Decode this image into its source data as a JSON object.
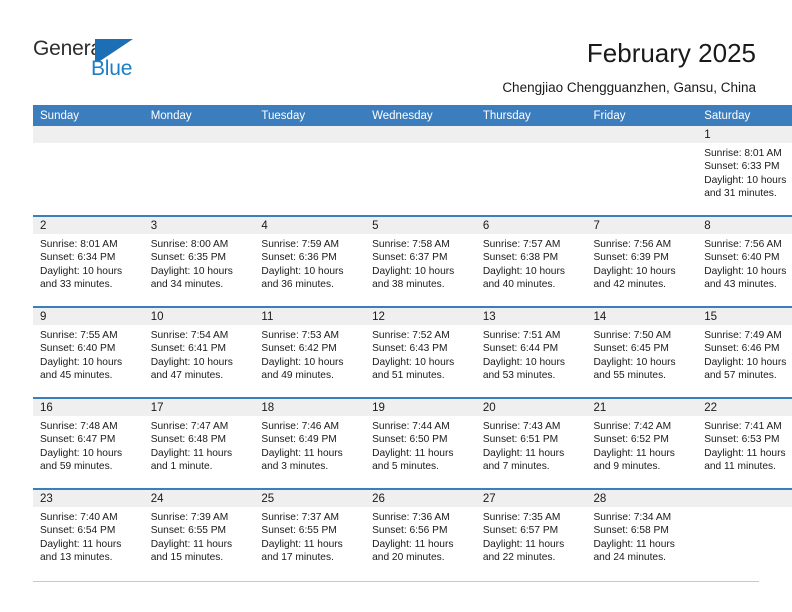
{
  "brand": {
    "name_part1": "General",
    "name_part2": "Blue",
    "logo_icon": "triangle-flag-icon",
    "accent_color": "#1c7fc4"
  },
  "header": {
    "title": "February 2025",
    "subtitle": "Chengjiao Chengguanzhen, Gansu, China"
  },
  "calendar": {
    "header_bg": "#3b7dbd",
    "daynum_band_bg": "#efefef",
    "weekdays": [
      "Sunday",
      "Monday",
      "Tuesday",
      "Wednesday",
      "Thursday",
      "Friday",
      "Saturday"
    ],
    "weeks": [
      [
        {
          "day": "",
          "sunrise": "",
          "sunset": "",
          "daylight": "",
          "empty": true
        },
        {
          "day": "",
          "sunrise": "",
          "sunset": "",
          "daylight": "",
          "empty": true
        },
        {
          "day": "",
          "sunrise": "",
          "sunset": "",
          "daylight": "",
          "empty": true
        },
        {
          "day": "",
          "sunrise": "",
          "sunset": "",
          "daylight": "",
          "empty": true
        },
        {
          "day": "",
          "sunrise": "",
          "sunset": "",
          "daylight": "",
          "empty": true
        },
        {
          "day": "",
          "sunrise": "",
          "sunset": "",
          "daylight": "",
          "empty": true
        },
        {
          "day": "1",
          "sunrise": "Sunrise: 8:01 AM",
          "sunset": "Sunset: 6:33 PM",
          "daylight": "Daylight: 10 hours and 31 minutes.",
          "empty": false
        }
      ],
      [
        {
          "day": "2",
          "sunrise": "Sunrise: 8:01 AM",
          "sunset": "Sunset: 6:34 PM",
          "daylight": "Daylight: 10 hours and 33 minutes.",
          "empty": false
        },
        {
          "day": "3",
          "sunrise": "Sunrise: 8:00 AM",
          "sunset": "Sunset: 6:35 PM",
          "daylight": "Daylight: 10 hours and 34 minutes.",
          "empty": false
        },
        {
          "day": "4",
          "sunrise": "Sunrise: 7:59 AM",
          "sunset": "Sunset: 6:36 PM",
          "daylight": "Daylight: 10 hours and 36 minutes.",
          "empty": false
        },
        {
          "day": "5",
          "sunrise": "Sunrise: 7:58 AM",
          "sunset": "Sunset: 6:37 PM",
          "daylight": "Daylight: 10 hours and 38 minutes.",
          "empty": false
        },
        {
          "day": "6",
          "sunrise": "Sunrise: 7:57 AM",
          "sunset": "Sunset: 6:38 PM",
          "daylight": "Daylight: 10 hours and 40 minutes.",
          "empty": false
        },
        {
          "day": "7",
          "sunrise": "Sunrise: 7:56 AM",
          "sunset": "Sunset: 6:39 PM",
          "daylight": "Daylight: 10 hours and 42 minutes.",
          "empty": false
        },
        {
          "day": "8",
          "sunrise": "Sunrise: 7:56 AM",
          "sunset": "Sunset: 6:40 PM",
          "daylight": "Daylight: 10 hours and 43 minutes.",
          "empty": false
        }
      ],
      [
        {
          "day": "9",
          "sunrise": "Sunrise: 7:55 AM",
          "sunset": "Sunset: 6:40 PM",
          "daylight": "Daylight: 10 hours and 45 minutes.",
          "empty": false
        },
        {
          "day": "10",
          "sunrise": "Sunrise: 7:54 AM",
          "sunset": "Sunset: 6:41 PM",
          "daylight": "Daylight: 10 hours and 47 minutes.",
          "empty": false
        },
        {
          "day": "11",
          "sunrise": "Sunrise: 7:53 AM",
          "sunset": "Sunset: 6:42 PM",
          "daylight": "Daylight: 10 hours and 49 minutes.",
          "empty": false
        },
        {
          "day": "12",
          "sunrise": "Sunrise: 7:52 AM",
          "sunset": "Sunset: 6:43 PM",
          "daylight": "Daylight: 10 hours and 51 minutes.",
          "empty": false
        },
        {
          "day": "13",
          "sunrise": "Sunrise: 7:51 AM",
          "sunset": "Sunset: 6:44 PM",
          "daylight": "Daylight: 10 hours and 53 minutes.",
          "empty": false
        },
        {
          "day": "14",
          "sunrise": "Sunrise: 7:50 AM",
          "sunset": "Sunset: 6:45 PM",
          "daylight": "Daylight: 10 hours and 55 minutes.",
          "empty": false
        },
        {
          "day": "15",
          "sunrise": "Sunrise: 7:49 AM",
          "sunset": "Sunset: 6:46 PM",
          "daylight": "Daylight: 10 hours and 57 minutes.",
          "empty": false
        }
      ],
      [
        {
          "day": "16",
          "sunrise": "Sunrise: 7:48 AM",
          "sunset": "Sunset: 6:47 PM",
          "daylight": "Daylight: 10 hours and 59 minutes.",
          "empty": false
        },
        {
          "day": "17",
          "sunrise": "Sunrise: 7:47 AM",
          "sunset": "Sunset: 6:48 PM",
          "daylight": "Daylight: 11 hours and 1 minute.",
          "empty": false
        },
        {
          "day": "18",
          "sunrise": "Sunrise: 7:46 AM",
          "sunset": "Sunset: 6:49 PM",
          "daylight": "Daylight: 11 hours and 3 minutes.",
          "empty": false
        },
        {
          "day": "19",
          "sunrise": "Sunrise: 7:44 AM",
          "sunset": "Sunset: 6:50 PM",
          "daylight": "Daylight: 11 hours and 5 minutes.",
          "empty": false
        },
        {
          "day": "20",
          "sunrise": "Sunrise: 7:43 AM",
          "sunset": "Sunset: 6:51 PM",
          "daylight": "Daylight: 11 hours and 7 minutes.",
          "empty": false
        },
        {
          "day": "21",
          "sunrise": "Sunrise: 7:42 AM",
          "sunset": "Sunset: 6:52 PM",
          "daylight": "Daylight: 11 hours and 9 minutes.",
          "empty": false
        },
        {
          "day": "22",
          "sunrise": "Sunrise: 7:41 AM",
          "sunset": "Sunset: 6:53 PM",
          "daylight": "Daylight: 11 hours and 11 minutes.",
          "empty": false
        }
      ],
      [
        {
          "day": "23",
          "sunrise": "Sunrise: 7:40 AM",
          "sunset": "Sunset: 6:54 PM",
          "daylight": "Daylight: 11 hours and 13 minutes.",
          "empty": false
        },
        {
          "day": "24",
          "sunrise": "Sunrise: 7:39 AM",
          "sunset": "Sunset: 6:55 PM",
          "daylight": "Daylight: 11 hours and 15 minutes.",
          "empty": false
        },
        {
          "day": "25",
          "sunrise": "Sunrise: 7:37 AM",
          "sunset": "Sunset: 6:55 PM",
          "daylight": "Daylight: 11 hours and 17 minutes.",
          "empty": false
        },
        {
          "day": "26",
          "sunrise": "Sunrise: 7:36 AM",
          "sunset": "Sunset: 6:56 PM",
          "daylight": "Daylight: 11 hours and 20 minutes.",
          "empty": false
        },
        {
          "day": "27",
          "sunrise": "Sunrise: 7:35 AM",
          "sunset": "Sunset: 6:57 PM",
          "daylight": "Daylight: 11 hours and 22 minutes.",
          "empty": false
        },
        {
          "day": "28",
          "sunrise": "Sunrise: 7:34 AM",
          "sunset": "Sunset: 6:58 PM",
          "daylight": "Daylight: 11 hours and 24 minutes.",
          "empty": false
        },
        {
          "day": "",
          "sunrise": "",
          "sunset": "",
          "daylight": "",
          "empty": true
        }
      ]
    ]
  }
}
